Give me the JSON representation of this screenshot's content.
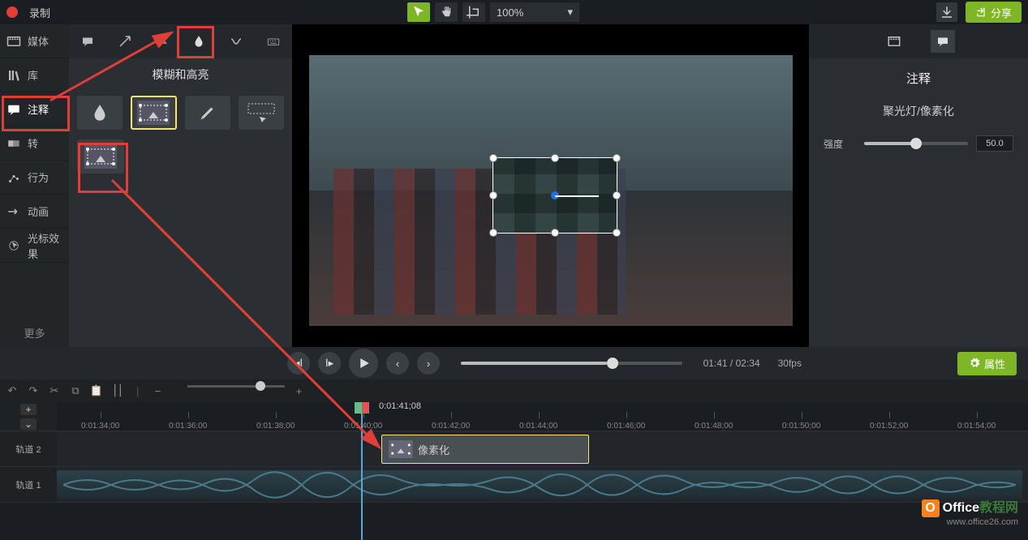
{
  "topbar": {
    "record_label": "录制",
    "zoom": "100%",
    "share_label": "分享"
  },
  "sidebar": {
    "items": [
      {
        "label": "媒体"
      },
      {
        "label": "库"
      },
      {
        "label": "注释"
      },
      {
        "label": "转"
      },
      {
        "label": "行为"
      },
      {
        "label": "动画"
      },
      {
        "label": "光标效果"
      }
    ],
    "more": "更多"
  },
  "tool_panel": {
    "title": "模糊和高亮"
  },
  "props": {
    "title": "注释",
    "subtitle": "聚光灯/像素化",
    "intensity_label": "强度",
    "intensity_value": "50.0"
  },
  "playback": {
    "time": "01:41 / 02:34",
    "fps": "30fps",
    "quality_label": "属性"
  },
  "timeline": {
    "playhead_time": "0:01:41;08",
    "ticks": [
      "0:01:34;00",
      "0:01:36;00",
      "0:01:38;00",
      "0:01:40;00",
      "0:01:42;00",
      "0:01:44;00",
      "0:01:46;00",
      "0:01:48;00",
      "0:01:50;00",
      "0:01:52;00",
      "0:01:54;00"
    ],
    "tracks": [
      {
        "label": "轨道 2"
      },
      {
        "label": "轨道 1"
      }
    ],
    "clip_label": "像素化"
  },
  "watermark": {
    "title_prefix": "Office",
    "title_suffix": "教程网",
    "url": "www.office26.com",
    "badge": "O"
  }
}
